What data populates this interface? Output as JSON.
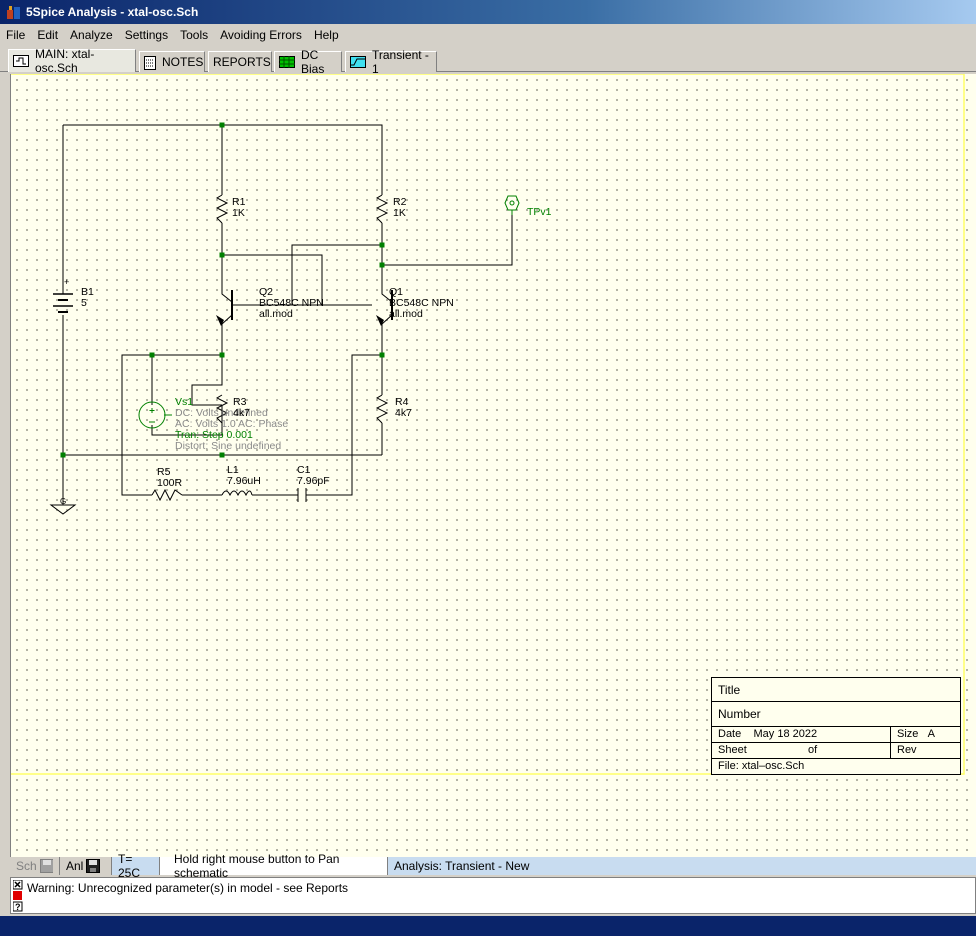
{
  "window": {
    "title": "5Spice Analysis - xtal-osc.Sch"
  },
  "menu": [
    "File",
    "Edit",
    "Analyze",
    "Settings",
    "Tools",
    "Avoiding Errors",
    "Help"
  ],
  "tabs": {
    "main": "MAIN:  xtal-osc.Sch",
    "notes": "NOTES",
    "reports": "REPORTS",
    "dcbias": "DC Bias",
    "transient": "Transient - 1"
  },
  "schematic": {
    "r1": {
      "name": "R1",
      "value": "1K"
    },
    "r2": {
      "name": "R2",
      "value": "1K"
    },
    "tpv1": "TPv1",
    "b1": {
      "name": "B1",
      "value": "5",
      "plus": "+"
    },
    "q2": {
      "name": "Q2",
      "model": "BC548C  NPN",
      "lib": "all.mod"
    },
    "q1": {
      "name": "Q1",
      "model": "BC548C  NPN",
      "lib": "all.mod"
    },
    "vs1": {
      "name": "Vs1",
      "dc": "DC: Volts undefined",
      "ac": "AC: Volts  1.0  AC: Phase",
      "tran": "Tran: Step  0.001",
      "distort": "Distort:  Sine  undefined"
    },
    "r3": {
      "name": "R3",
      "value": "4k7"
    },
    "r4": {
      "name": "R4",
      "value": "4k7"
    },
    "r5": {
      "name": "R5",
      "value": "100R"
    },
    "l1": {
      "name": "L1",
      "value": "7.96uH"
    },
    "c1": {
      "name": "C1",
      "value": "7.96pF"
    },
    "gnd": "G"
  },
  "titleblock": {
    "title": "Title",
    "number": "Number",
    "date_label": "Date",
    "date": "May 18 2022",
    "size_label": "Size",
    "size": "A",
    "sheet_label": "Sheet",
    "of_label": "of",
    "rev_label": "Rev",
    "file": "File:  xtal–osc.Sch"
  },
  "status": {
    "sch": "Sch",
    "anl": "Anl",
    "temp": "T= 25C",
    "hint": "Hold right mouse button to Pan schematic",
    "analysis": "Analysis:  Transient - New"
  },
  "message": "Warning: Unrecognized parameter(s) in model - see Reports",
  "colors": {
    "wire": "#000000",
    "node": "#008000",
    "source": "#008000",
    "canvas": "#ffffee",
    "border": "#ffff66"
  }
}
